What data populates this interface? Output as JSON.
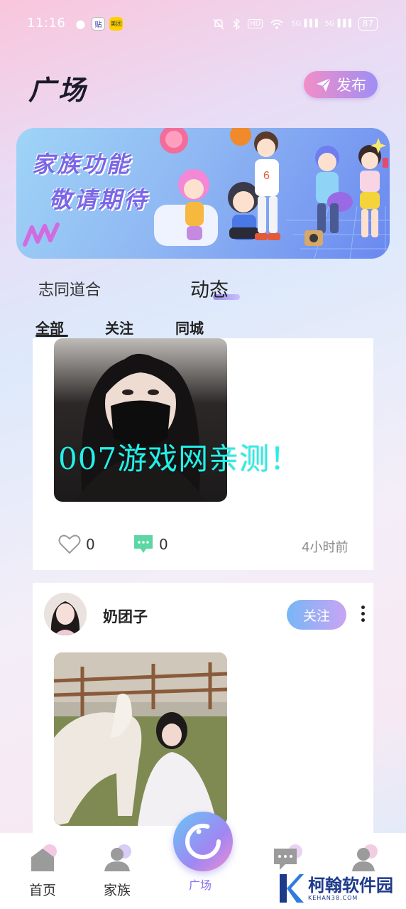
{
  "status_bar": {
    "time": "11:16",
    "app_icons": [
      "wechat-icon",
      "tieba-icon",
      "meituan-icon"
    ],
    "tie_label": "贴",
    "meituan_label": "美团",
    "hd_label": "HD",
    "net1": "5G",
    "net2": "5G",
    "battery": "87"
  },
  "header": {
    "title": "广场",
    "publish_label": "发布"
  },
  "banner": {
    "line1": "家族功能",
    "line2": "敬请期待"
  },
  "main_tabs": [
    {
      "label": "志同道合",
      "active": false
    },
    {
      "label": "动态",
      "active": true
    }
  ],
  "sub_tabs": [
    {
      "label": "全部",
      "active": true
    },
    {
      "label": "关注",
      "active": false
    },
    {
      "label": "同城",
      "active": false
    }
  ],
  "watermark_text": "007游戏网亲测！",
  "posts": [
    {
      "likes": "0",
      "comments": "0",
      "time_ago": "4小时前"
    },
    {
      "user_name": "奶团子",
      "follow_label": "关注"
    }
  ],
  "bottom_nav": [
    {
      "label": "首页"
    },
    {
      "label": "家族"
    },
    {
      "label": "广场",
      "active": true
    },
    {
      "label": "",
      "icon": "message-icon"
    },
    {
      "label": "",
      "icon": "profile-icon"
    }
  ],
  "brand": {
    "name": "柯翰软件园",
    "url": "KEHAN38.COM"
  },
  "colors": {
    "accent_purple": "#8b6ff0",
    "watermark_cyan": "#23f0e8",
    "brand_blue": "#1d3a8a"
  }
}
